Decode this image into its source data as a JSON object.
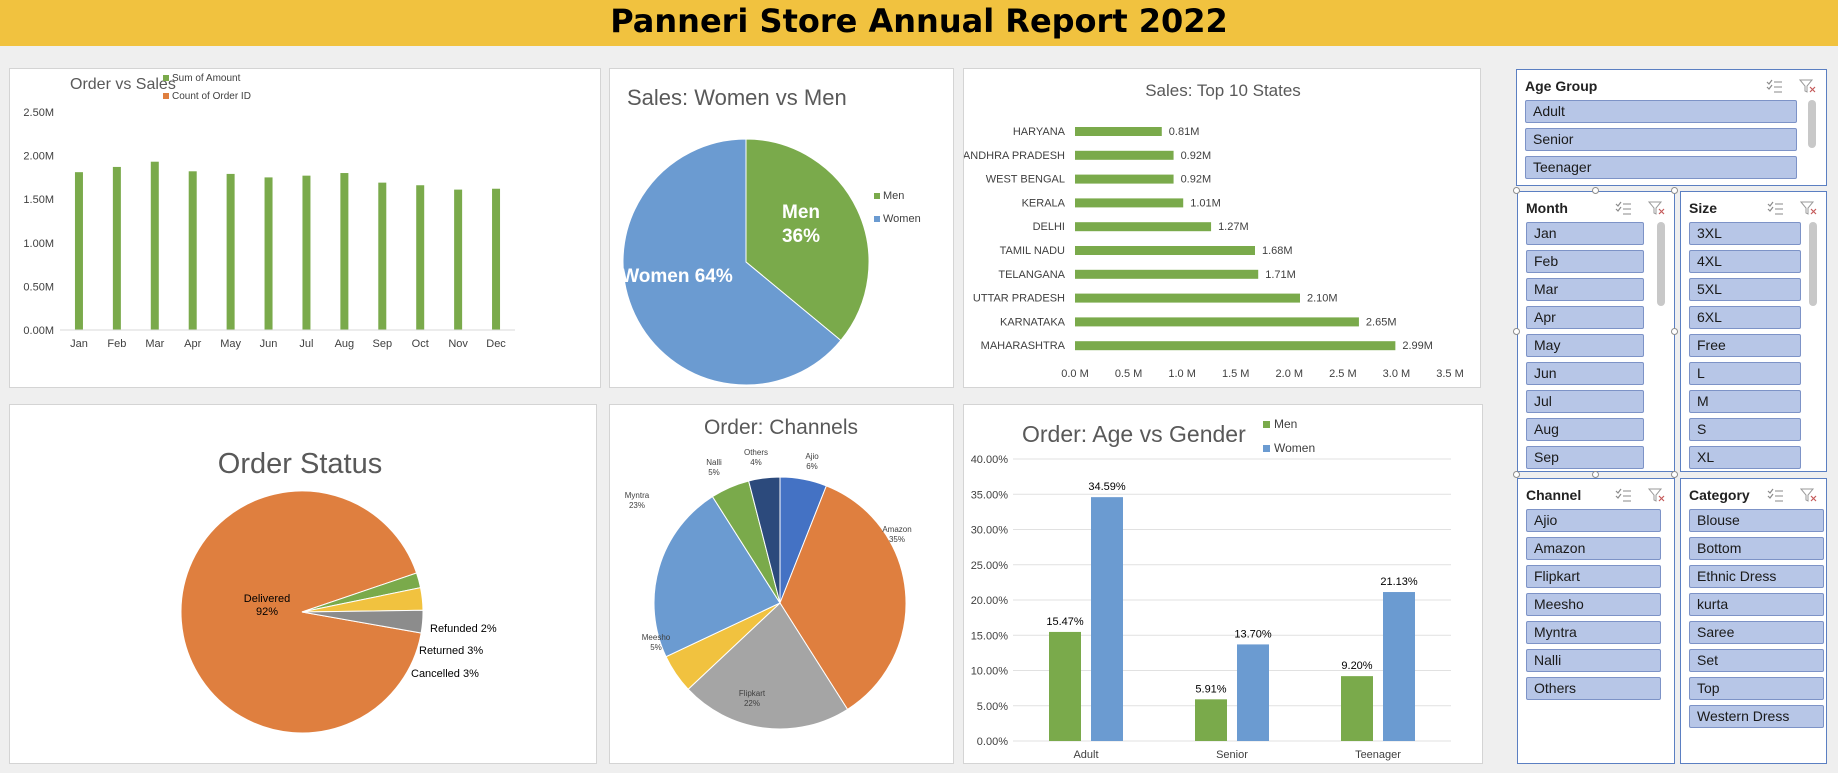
{
  "title": "Panneri Store Annual Report 2022",
  "colors": {
    "banner": "#f1c23f",
    "green": "#7aaa4b",
    "blue": "#6b9bd1",
    "orange": "#df7f3f",
    "gray": "#a5a5a5",
    "yellow": "#f1c23f",
    "navy": "#2c4a7c",
    "slicer_item": "#b7c6e7"
  },
  "charts": {
    "order_vs_sales": {
      "chart_data": {
        "type": "bar",
        "title": "Order vs Sales",
        "categories": [
          "Jan",
          "Feb",
          "Mar",
          "Apr",
          "May",
          "Jun",
          "Jul",
          "Aug",
          "Sep",
          "Oct",
          "Nov",
          "Dec"
        ],
        "series": [
          {
            "name": "Sum of Amount",
            "values": [
              1.81,
              1.87,
              1.93,
              1.82,
              1.79,
              1.75,
              1.77,
              1.8,
              1.69,
              1.66,
              1.61,
              1.62
            ]
          },
          {
            "name": "Count of Order ID",
            "values": [
              0,
              0,
              0,
              0,
              0,
              0,
              0,
              0,
              0,
              0,
              0,
              0
            ]
          }
        ],
        "y_ticks": [
          "0.00M",
          "0.50M",
          "1.00M",
          "1.50M",
          "2.00M",
          "2.50M"
        ],
        "ylim": [
          0,
          2.5
        ],
        "legend": "top"
      }
    },
    "women_vs_men": {
      "chart_data": {
        "type": "pie",
        "title": "Sales: Women vs Men",
        "slices": [
          {
            "label": "Men",
            "value": 36,
            "color": "#7aaa4b",
            "data_label": "Men\n36%"
          },
          {
            "label": "Women",
            "value": 64,
            "color": "#6b9bd1",
            "data_label": "Women 64%"
          }
        ],
        "legend": [
          "Men",
          "Women"
        ]
      }
    },
    "top_states": {
      "chart_data": {
        "type": "bar",
        "orientation": "horizontal",
        "title": "Sales: Top 10 States",
        "categories": [
          "HARYANA",
          "ANDHRA PRADESH",
          "WEST BENGAL",
          "KERALA",
          "DELHI",
          "TAMIL NADU",
          "TELANGANA",
          "UTTAR PRADESH",
          "KARNATAKA",
          "MAHARASHTRA"
        ],
        "values": [
          0.81,
          0.92,
          0.92,
          1.01,
          1.27,
          1.68,
          1.71,
          2.1,
          2.65,
          2.99
        ],
        "data_labels": [
          "0.81M",
          "0.92M",
          "0.92M",
          "1.01M",
          "1.27M",
          "1.68M",
          "1.71M",
          "2.10M",
          "2.65M",
          "2.99M"
        ],
        "x_ticks": [
          "0.0 M",
          "0.5 M",
          "1.0 M",
          "1.5 M",
          "2.0 M",
          "2.5 M",
          "3.0 M",
          "3.5 M"
        ],
        "xlim": [
          0,
          3.5
        ]
      }
    },
    "order_status": {
      "chart_data": {
        "type": "pie",
        "title": "Order Status",
        "slices": [
          {
            "label": "Delivered",
            "value": 92,
            "color": "#df7f3f",
            "data_label": "Delivered\n92%"
          },
          {
            "label": "Refunded",
            "value": 2,
            "color": "#7aaa4b",
            "data_label": "Refunded 2%"
          },
          {
            "label": "Returned",
            "value": 3,
            "color": "#f1c23f",
            "data_label": "Returned 3%"
          },
          {
            "label": "Cancelled",
            "value": 3,
            "color": "#8c8c8c",
            "data_label": "Cancelled 3%"
          }
        ]
      }
    },
    "channels": {
      "chart_data": {
        "type": "pie",
        "title": "Order: Channels",
        "slices": [
          {
            "label": "Ajio",
            "value": 6,
            "color": "#4472c4",
            "data_label": "Ajio\n6%"
          },
          {
            "label": "Amazon",
            "value": 35,
            "color": "#df7f3f",
            "data_label": "Amazon\n35%"
          },
          {
            "label": "Flipkart",
            "value": 22,
            "color": "#a5a5a5",
            "data_label": "Flipkart\n22%"
          },
          {
            "label": "Meesho",
            "value": 5,
            "color": "#f1c23f",
            "data_label": "Meesho\n5%"
          },
          {
            "label": "Myntra",
            "value": 23,
            "color": "#6b9bd1",
            "data_label": "Myntra\n23%"
          },
          {
            "label": "Nalli",
            "value": 5,
            "color": "#7aaa4b",
            "data_label": "Nalli\n5%"
          },
          {
            "label": "Others",
            "value": 4,
            "color": "#2c4a7c",
            "data_label": "Others\n4%"
          }
        ]
      }
    },
    "age_vs_gender": {
      "chart_data": {
        "type": "bar",
        "title": "Order: Age vs Gender",
        "categories": [
          "Adult",
          "Senior",
          "Teenager"
        ],
        "series": [
          {
            "name": "Men",
            "values": [
              15.47,
              5.91,
              9.2
            ],
            "labels": [
              "15.47%",
              "5.91%",
              "9.20%"
            ]
          },
          {
            "name": "Women",
            "values": [
              34.59,
              13.7,
              21.13
            ],
            "labels": [
              "34.59%",
              "13.70%",
              "21.13%"
            ]
          }
        ],
        "y_ticks": [
          "0.00%",
          "5.00%",
          "10.00%",
          "15.00%",
          "20.00%",
          "25.00%",
          "30.00%",
          "35.00%",
          "40.00%"
        ],
        "ylim": [
          0,
          40
        ],
        "legend": "top"
      }
    }
  },
  "slicers": {
    "age_group": {
      "title": "Age Group",
      "items": [
        "Adult",
        "Senior",
        "Teenager"
      ]
    },
    "month": {
      "title": "Month",
      "items": [
        "Jan",
        "Feb",
        "Mar",
        "Apr",
        "May",
        "Jun",
        "Jul",
        "Aug",
        "Sep"
      ]
    },
    "size": {
      "title": "Size",
      "items": [
        "3XL",
        "4XL",
        "5XL",
        "6XL",
        "Free",
        "L",
        "M",
        "S",
        "XL"
      ]
    },
    "channel": {
      "title": "Channel",
      "items": [
        "Ajio",
        "Amazon",
        "Flipkart",
        "Meesho",
        "Myntra",
        "Nalli",
        "Others"
      ]
    },
    "category": {
      "title": "Category",
      "items": [
        "Blouse",
        "Bottom",
        "Ethnic Dress",
        "kurta",
        "Saree",
        "Set",
        "Top",
        "Western Dress"
      ]
    }
  }
}
